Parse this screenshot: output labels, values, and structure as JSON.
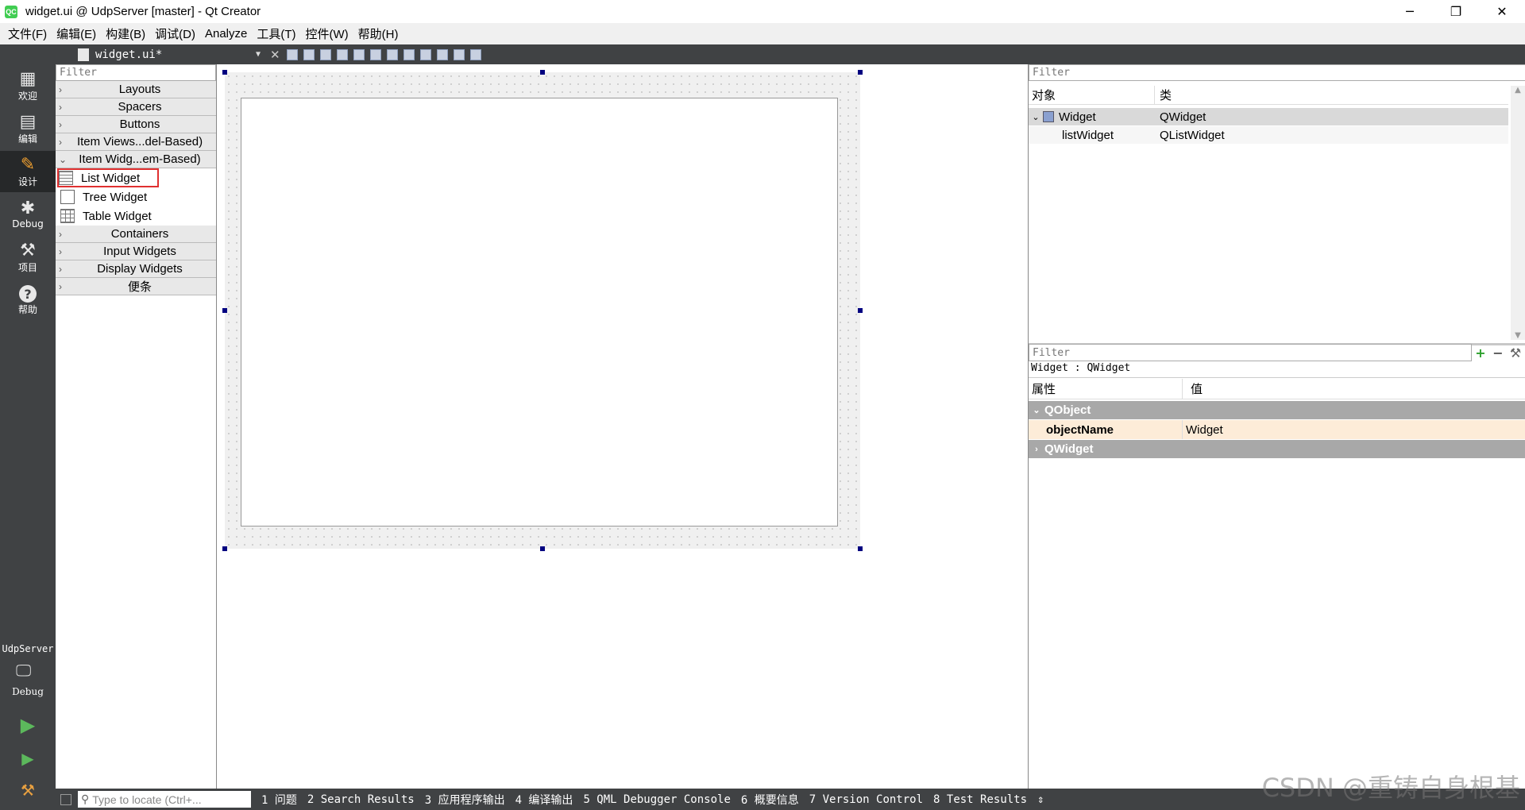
{
  "window": {
    "title": "widget.ui @ UdpServer [master] - Qt Creator",
    "app_icon": "QC",
    "controls": [
      "minimize-icon",
      "restore-icon",
      "close-icon"
    ]
  },
  "menubar": {
    "items": [
      "文件(F)",
      "编辑(E)",
      "构建(B)",
      "调试(D)",
      "Analyze",
      "工具(T)",
      "控件(W)",
      "帮助(H)"
    ]
  },
  "modes": [
    {
      "label": "欢迎",
      "icon": "grid-icon",
      "glyph": "▦"
    },
    {
      "label": "编辑",
      "icon": "edit-doc-icon",
      "glyph": "▤"
    },
    {
      "label": "设计",
      "icon": "pencil-icon",
      "glyph": "✎"
    },
    {
      "label": "Debug",
      "icon": "bug-icon",
      "glyph": "✱"
    },
    {
      "label": "项目",
      "icon": "wrench-icon",
      "glyph": "⚒"
    },
    {
      "label": "帮助",
      "icon": "help-icon",
      "glyph": "?"
    }
  ],
  "kit": {
    "project": "UdpServer",
    "build": "Debug"
  },
  "editor": {
    "document": "widget.ui*"
  },
  "widgetbox": {
    "filter_placeholder": "Filter",
    "categories_top": [
      "Layouts",
      "Spacers",
      "Buttons",
      "Item Views...del-Based)"
    ],
    "expanded_category": "Item Widg...em-Based)",
    "items": [
      "List Widget",
      "Tree Widget",
      "Table Widget"
    ],
    "categories_bottom": [
      "Containers",
      "Input Widgets",
      "Display Widgets",
      "便条"
    ]
  },
  "object_inspector": {
    "filter_placeholder": "Filter",
    "col_object": "对象",
    "col_class": "类",
    "rows": [
      {
        "object": "Widget",
        "class": "QWidget"
      },
      {
        "object": "listWidget",
        "class": "QListWidget"
      }
    ]
  },
  "property_editor": {
    "filter_placeholder": "Filter",
    "title": "Widget : QWidget",
    "col_property": "属性",
    "col_value": "值",
    "group1": "QObject",
    "prop_name": "objectName",
    "prop_value": "Widget",
    "group2": "QWidget"
  },
  "statusbar": {
    "locator_placeholder": "Type to locate (Ctrl+...",
    "panes": [
      "1 问题",
      "2 Search Results",
      "3 应用程序输出",
      "4 编译输出",
      "5 QML Debugger Console",
      "6 概要信息",
      "7 Version Control",
      "8 Test Results"
    ]
  },
  "watermark": "CSDN @重铸自身根基"
}
